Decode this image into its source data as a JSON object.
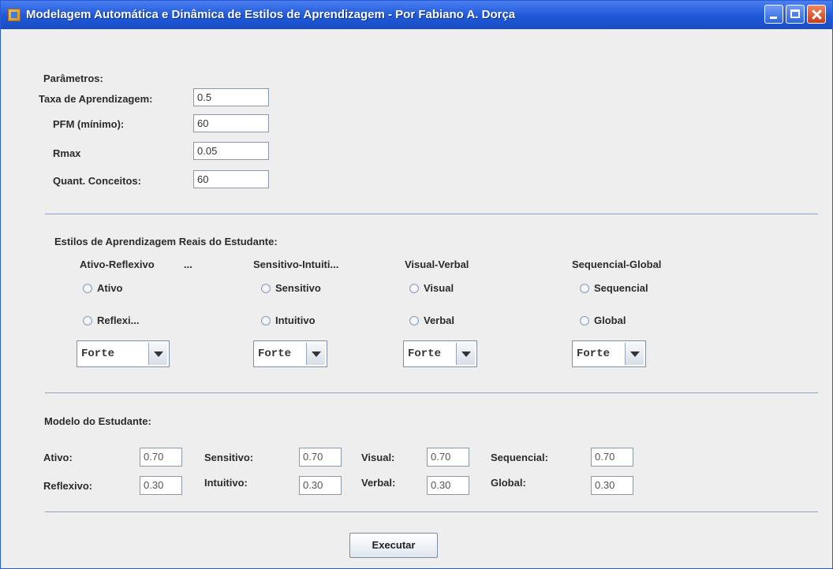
{
  "window": {
    "title": "Modelagem Automática e Dinâmica de Estilos de Aprendizagem - Por Fabiano A. Dorça"
  },
  "parametros": {
    "heading": "Parâmetros:",
    "taxa_label": "Taxa de Aprendizagem:",
    "taxa_value": "0.5",
    "pfm_label": "PFM (mínimo):",
    "pfm_value": "60",
    "rmax_label": "Rmax",
    "rmax_value": "0.05",
    "quant_label": "Quant. Conceitos:",
    "quant_value": "60"
  },
  "estilos": {
    "heading": "Estilos de Aprendizagem Reais do Estudante:",
    "groups": [
      {
        "title": "Ativo-Reflexivo",
        "title_suffix": "...",
        "option1": "Ativo",
        "option2": "Reflexi...",
        "combo": "Forte"
      },
      {
        "title": "Sensitivo-Intuiti...",
        "option1": "Sensitivo",
        "option2": "Intuitivo",
        "combo": "Forte"
      },
      {
        "title": "Visual-Verbal",
        "option1": "Visual",
        "option2": "Verbal",
        "combo": "Forte"
      },
      {
        "title": "Sequencial-Global",
        "option1": "Sequencial",
        "option2": "Global",
        "combo": "Forte"
      }
    ]
  },
  "modelo": {
    "heading": "Modelo do Estudante:",
    "ativo_label": "Ativo:",
    "ativo_value": "0.70",
    "reflexivo_label": "Reflexivo:",
    "reflexivo_value": "0.30",
    "sensitivo_label": "Sensitivo:",
    "sensitivo_value": "0.70",
    "intuitivo_label": "Intuitivo:",
    "intuitivo_value": "0.30",
    "visual_label": "Visual:",
    "visual_value": "0.70",
    "verbal_label": "Verbal:",
    "verbal_value": "0.30",
    "sequencial_label": "Sequencial:",
    "sequencial_value": "0.70",
    "global_label": "Global:",
    "global_value": "0.30"
  },
  "actions": {
    "executar": "Executar"
  }
}
